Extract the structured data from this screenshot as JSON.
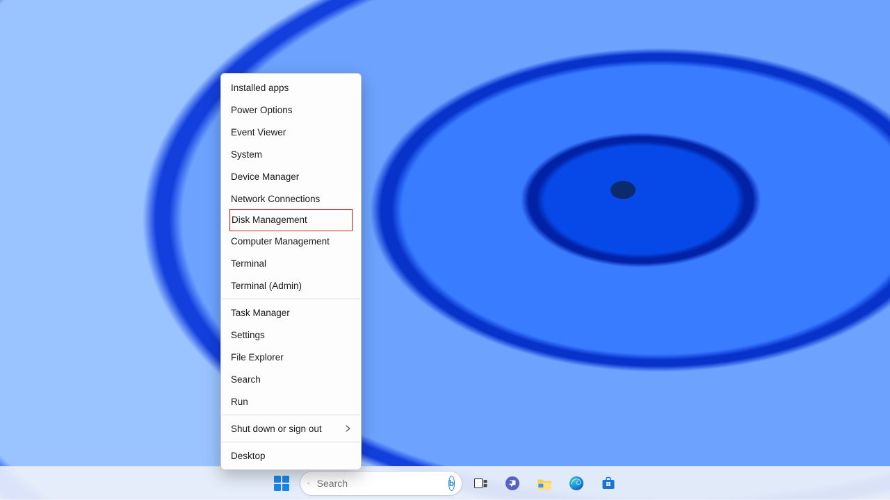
{
  "menu": {
    "groups": [
      [
        {
          "label": "Installed apps",
          "name": "menu-installed-apps"
        },
        {
          "label": "Power Options",
          "name": "menu-power-options"
        },
        {
          "label": "Event Viewer",
          "name": "menu-event-viewer"
        },
        {
          "label": "System",
          "name": "menu-system"
        },
        {
          "label": "Device Manager",
          "name": "menu-device-manager"
        },
        {
          "label": "Network Connections",
          "name": "menu-network-connections"
        },
        {
          "label": "Disk Management",
          "name": "menu-disk-management",
          "highlighted": true
        },
        {
          "label": "Computer Management",
          "name": "menu-computer-management"
        },
        {
          "label": "Terminal",
          "name": "menu-terminal"
        },
        {
          "label": "Terminal (Admin)",
          "name": "menu-terminal-admin"
        }
      ],
      [
        {
          "label": "Task Manager",
          "name": "menu-task-manager"
        },
        {
          "label": "Settings",
          "name": "menu-settings"
        },
        {
          "label": "File Explorer",
          "name": "menu-file-explorer"
        },
        {
          "label": "Search",
          "name": "menu-search"
        },
        {
          "label": "Run",
          "name": "menu-run"
        }
      ],
      [
        {
          "label": "Shut down or sign out",
          "name": "menu-shutdown-signout",
          "submenu": true
        }
      ],
      [
        {
          "label": "Desktop",
          "name": "menu-desktop"
        }
      ]
    ]
  },
  "taskbar": {
    "search_placeholder": "Search",
    "bing_label": "b",
    "pinned": [
      {
        "name": "start-button",
        "icon": "start"
      },
      {
        "name": "task-view-button",
        "icon": "taskview"
      },
      {
        "name": "chat-button",
        "icon": "chat"
      },
      {
        "name": "file-explorer-button",
        "icon": "explorer"
      },
      {
        "name": "edge-button",
        "icon": "edge"
      },
      {
        "name": "microsoft-store-button",
        "icon": "store"
      }
    ]
  }
}
